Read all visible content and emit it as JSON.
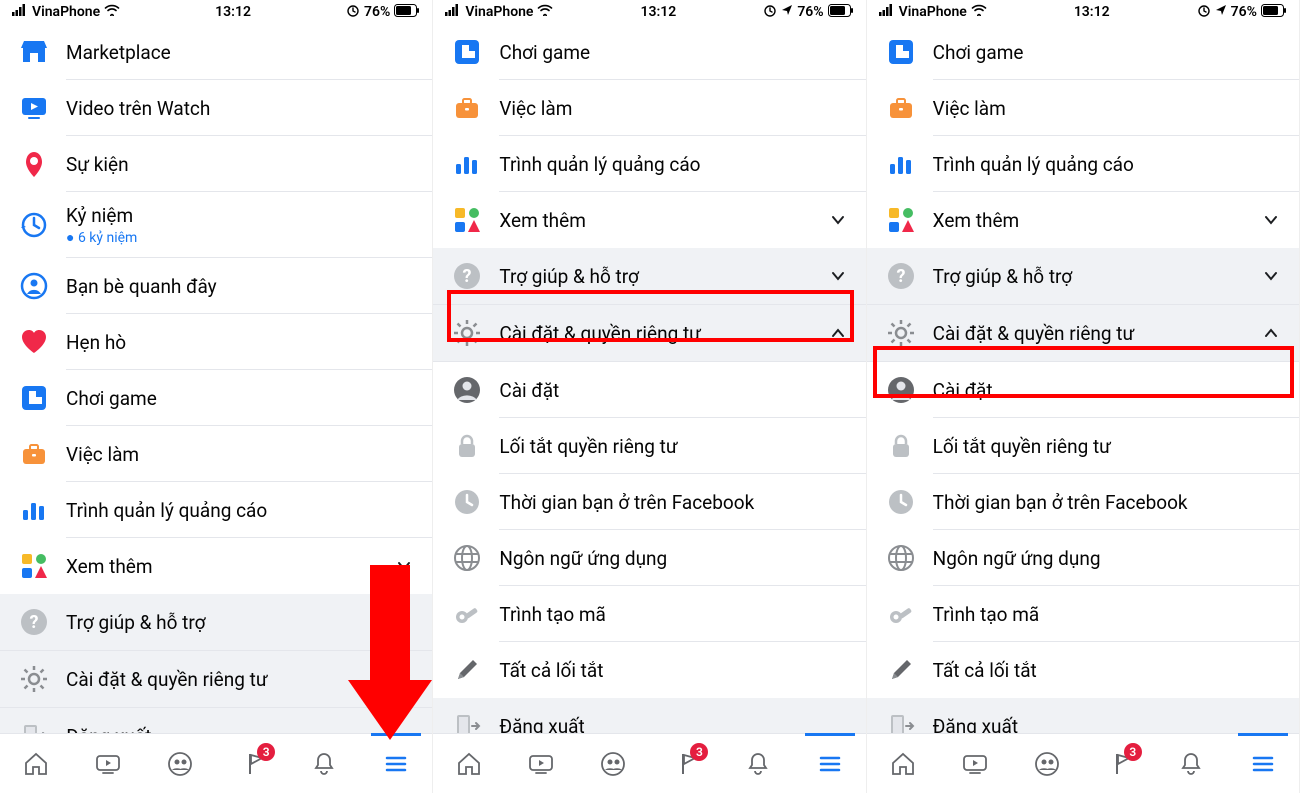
{
  "status": {
    "carrier": "VinaPhone",
    "time": "13:12",
    "battery": "76%"
  },
  "screen1": {
    "items": [
      {
        "key": "marketplace",
        "label": "Marketplace"
      },
      {
        "key": "watch",
        "label": "Video trên Watch"
      },
      {
        "key": "events",
        "label": "Sự kiện"
      },
      {
        "key": "memories",
        "label": "Kỷ niệm",
        "sub": "6 kỷ niệm"
      },
      {
        "key": "nearby",
        "label": "Bạn bè quanh đây"
      },
      {
        "key": "dating",
        "label": "Hẹn hò"
      },
      {
        "key": "gaming",
        "label": "Chơi game"
      },
      {
        "key": "jobs",
        "label": "Việc làm"
      },
      {
        "key": "ads",
        "label": "Trình quản lý quảng cáo"
      },
      {
        "key": "seemore",
        "label": "Xem thêm",
        "chevron": "down"
      }
    ],
    "sections": [
      {
        "key": "help",
        "label": "Trợ giúp & hỗ trợ",
        "chevron": "down"
      },
      {
        "key": "settings",
        "label": "Cài đặt & quyền riêng tư",
        "chevron": "down"
      },
      {
        "key": "logout",
        "label": "Đăng xuất"
      }
    ]
  },
  "screen23": {
    "items": [
      {
        "key": "gaming",
        "label": "Chơi game"
      },
      {
        "key": "jobs",
        "label": "Việc làm"
      },
      {
        "key": "ads",
        "label": "Trình quản lý quảng cáo"
      },
      {
        "key": "seemore",
        "label": "Xem thêm",
        "chevron": "down"
      }
    ],
    "sections": [
      {
        "key": "help",
        "label": "Trợ giúp & hỗ trợ",
        "chevron": "down"
      },
      {
        "key": "settings",
        "label": "Cài đặt & quyền riêng tư",
        "chevron": "up"
      }
    ],
    "subitems": [
      {
        "key": "cai-dat",
        "label": "Cài đặt"
      },
      {
        "key": "privacy-shortcuts",
        "label": "Lối tắt quyền riêng tư"
      },
      {
        "key": "time",
        "label": "Thời gian bạn ở trên Facebook"
      },
      {
        "key": "language",
        "label": "Ngôn ngữ ứng dụng"
      },
      {
        "key": "code",
        "label": "Trình tạo mã"
      },
      {
        "key": "shortcuts",
        "label": "Tất cả lối tắt"
      }
    ],
    "logout": {
      "label": "Đăng xuất"
    }
  },
  "nav": {
    "badge": "3"
  }
}
